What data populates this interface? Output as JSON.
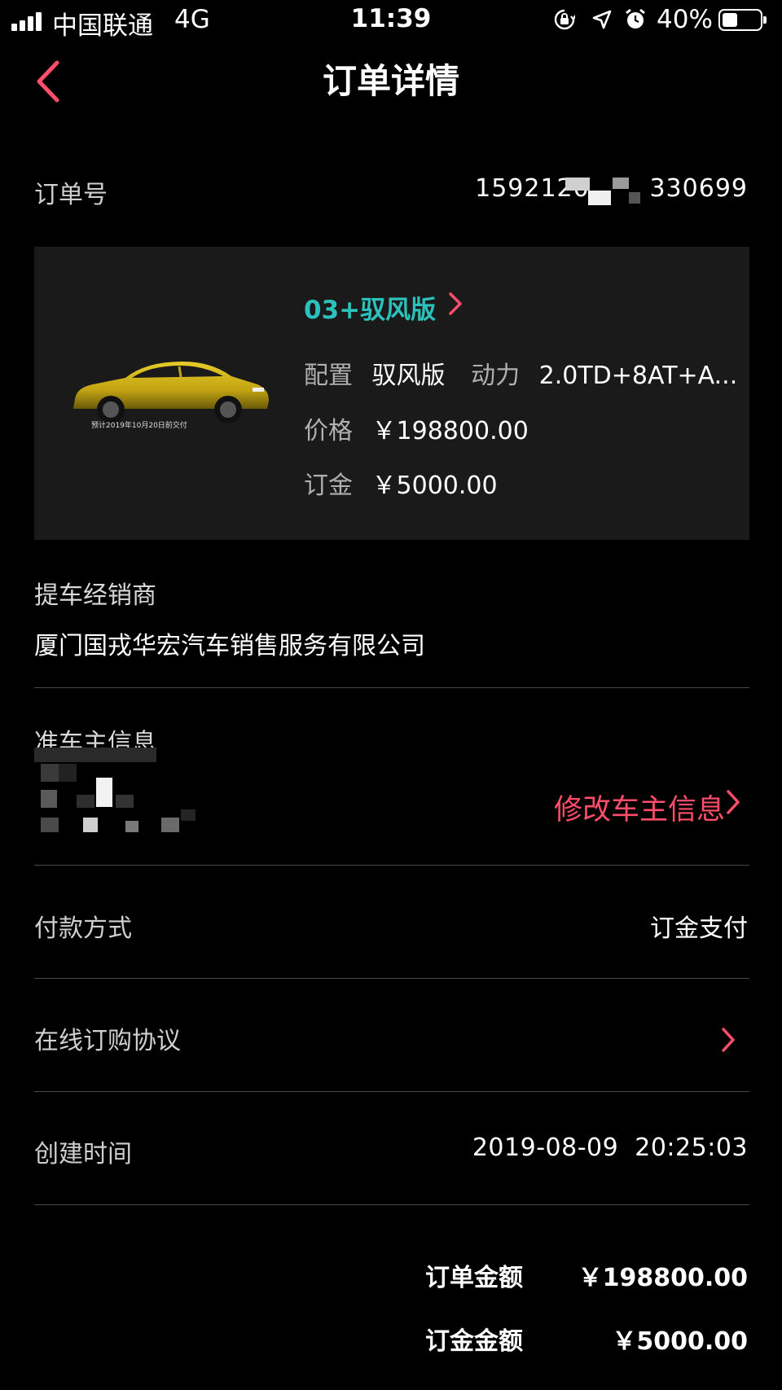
{
  "status_bar": {
    "carrier": "中国联通",
    "network": "4G",
    "time": "11:39",
    "battery": "40%",
    "battery_level": 0.4,
    "icons": [
      "signal-icon",
      "rotation-lock-icon",
      "location-arrow-icon",
      "alarm-icon",
      "battery-icon"
    ]
  },
  "nav": {
    "title": "订单详情",
    "back_icon": "chevron-left-icon"
  },
  "order": {
    "number_label": "订单号",
    "number_value": "1592120       330699"
  },
  "product": {
    "model": "03+驭风版",
    "image_caption": "预计2019年10月20日前交付",
    "config_label": "配置",
    "config_value": "驭风版",
    "power_label": "动力",
    "power_value": "2.0TD+8AT+A...",
    "price_label": "价格",
    "price_value": "￥198800.00",
    "deposit_label": "订金",
    "deposit_value": "￥5000.00"
  },
  "dealer": {
    "label": "提车经销商",
    "name": "厦门国戎华宏汽车销售服务有限公司"
  },
  "owner": {
    "label": "准车主信息",
    "edit_label": "修改车主信息"
  },
  "payment": {
    "label": "付款方式",
    "value": "订金支付"
  },
  "agreement": {
    "label": "在线订购协议"
  },
  "created": {
    "label": "创建时间",
    "value": "2019-08-09  20:25:03"
  },
  "summary": {
    "order_amount_label": "订单金额",
    "order_amount_value": "￥198800.00",
    "deposit_amount_label": "订金金额",
    "deposit_amount_value": "￥5000.00"
  },
  "colors": {
    "accent_red": "#ff4d6a",
    "model_teal": "#2cc1bb",
    "card_bg": "#1a1a1a",
    "car_yellow": "#c9a915"
  }
}
